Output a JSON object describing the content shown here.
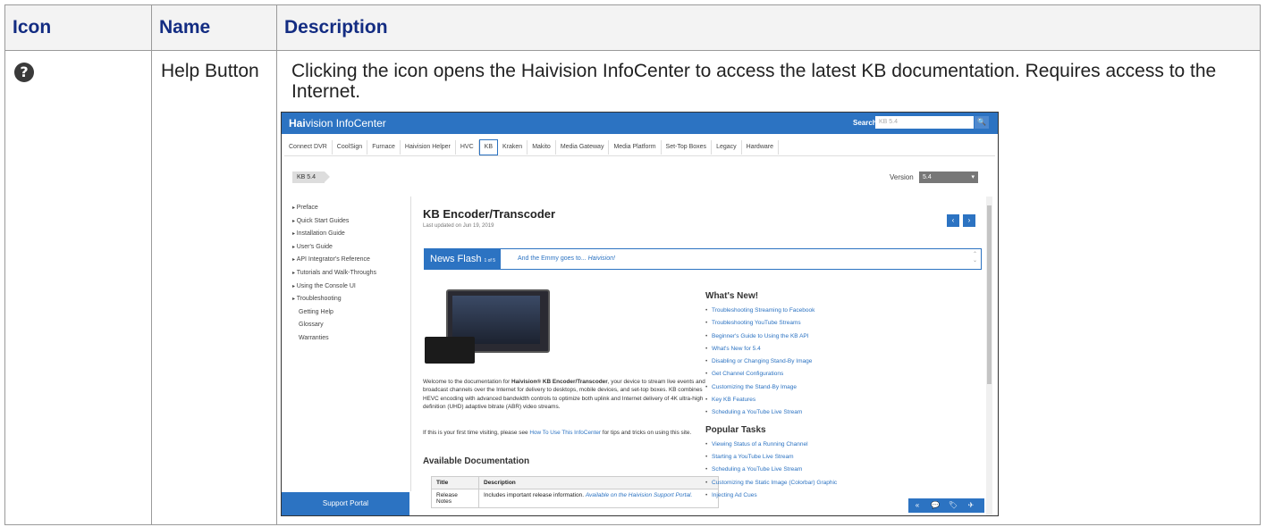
{
  "table": {
    "headers": {
      "icon": "Icon",
      "name": "Name",
      "description": "Description"
    },
    "row": {
      "icon_glyph": "?",
      "icon_name": "help-icon",
      "name": "Help Button",
      "description": "Clicking the icon opens the Haivision InfoCenter to access the latest KB documentation. Requires access to the Internet."
    }
  },
  "screenshot": {
    "brand_bold": "Hai",
    "brand_rest": "vision InfoCenter",
    "search_label": "Search",
    "search_value": "KB 5.4",
    "search_button": "🔍",
    "nav_tabs": [
      "Connect DVR",
      "CoolSign",
      "Furnace",
      "Haivision Helper",
      "HVC",
      "KB",
      "Kraken",
      "Makito",
      "Media Gateway",
      "Media Platform",
      "Set-Top Boxes",
      "Legacy",
      "Hardware"
    ],
    "active_tab": "KB",
    "breadcrumb": "KB 5.4",
    "version_label": "Version",
    "version_value": "5.4",
    "toc": [
      {
        "label": "Preface",
        "arrow": true
      },
      {
        "label": "Quick Start Guides",
        "arrow": true
      },
      {
        "label": "Installation Guide",
        "arrow": true
      },
      {
        "label": "User's Guide",
        "arrow": true
      },
      {
        "label": "API Integrator's Reference",
        "arrow": true
      },
      {
        "label": "Tutorials and Walk-Throughs",
        "arrow": true
      },
      {
        "label": "Using the Console UI",
        "arrow": true
      },
      {
        "label": "Troubleshooting",
        "arrow": true
      },
      {
        "label": "Getting Help",
        "arrow": false
      },
      {
        "label": "Glossary",
        "arrow": false
      },
      {
        "label": "Warranties",
        "arrow": false
      }
    ],
    "support_portal": "Support Portal",
    "doc_title": "KB Encoder/Transcoder",
    "doc_date": "Last updated on Jun 19, 2019",
    "prev": "‹",
    "next": "›",
    "news_label": "News Flash",
    "news_count": "1 of 5",
    "news_text": "And the Emmy goes to...",
    "news_text_italic": "Haivision!",
    "intro_start": "Welcome to the documentation for ",
    "intro_product": "Haivision® KB Encoder/Transcoder",
    "intro_rest": ", your device to stream live events and broadcast channels over the Internet for delivery to desktops, mobile devices, and set-top boxes. KB combines HEVC encoding with advanced bandwidth controls to optimize both uplink and Internet delivery of 4K ultra-high definition (UHD) adaptive bitrate (ABR) video streams.",
    "intro2_start": "If this is your first time visiting, please see ",
    "intro2_link": "How To Use This InfoCenter",
    "intro2_rest": " for tips and tricks on using this site.",
    "available_docs": "Available Documentation",
    "docs_table": {
      "headers": [
        "Title",
        "Description"
      ],
      "rows": [
        {
          "title": "Release Notes",
          "desc": "Includes important release information.",
          "desc_italic": "Available on the Haivision Support Portal."
        }
      ]
    },
    "whats_new_title": "What's New!",
    "whats_new": [
      "Troubleshooting Streaming to Facebook",
      "Troubleshooting YouTube Streams",
      "Beginner's Guide to Using the KB API",
      "What's New for 5.4",
      "Disabling or Changing Stand-By Image",
      "Get Channel Configurations",
      "Customizing the Stand-By Image",
      "Key KB Features",
      "Scheduling a YouTube Live Stream"
    ],
    "popular_title": "Popular Tasks",
    "popular": [
      "Viewing Status of a Running Channel",
      "Starting a YouTube Live Stream",
      "Scheduling a YouTube Live Stream",
      "Customizing the Static Image (Colorbar) Graphic",
      "Injecting Ad Cues"
    ],
    "toolbar": [
      "«",
      "💬",
      "🏷",
      "✈"
    ]
  }
}
